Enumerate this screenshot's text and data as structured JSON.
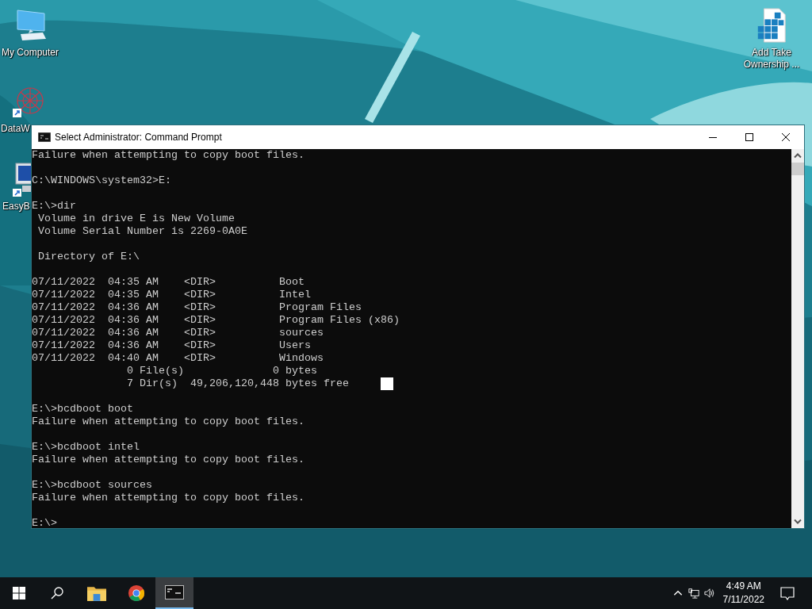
{
  "desktop": {
    "icons": [
      {
        "label": "My Computer",
        "kind": "computer",
        "shortcut": false
      },
      {
        "label": "DataW",
        "kind": "network",
        "shortcut": true
      },
      {
        "label": "EasyB",
        "kind": "easyb",
        "shortcut": true
      },
      {
        "label": "Add Take Ownership ...",
        "kind": "registry",
        "shortcut": false
      }
    ]
  },
  "window": {
    "title": "Select Administrator: Command Prompt",
    "console": [
      {
        "lines": [
          "Failure when attempting to copy boot files."
        ],
        "cursor": false
      },
      {
        "lines": [
          "C:\\WINDOWS\\system32>E:"
        ],
        "cursor": false
      },
      {
        "lines": [
          "E:\\>dir",
          " Volume in drive E is New Volume",
          " Volume Serial Number is 2269-0A0E"
        ],
        "cursor": false
      },
      {
        "lines": [
          " Directory of E:\\"
        ],
        "cursor": false
      },
      {
        "lines": [
          "07/11/2022  04:35 AM    <DIR>          Boot",
          "07/11/2022  04:35 AM    <DIR>          Intel",
          "07/11/2022  04:36 AM    <DIR>          Program Files",
          "07/11/2022  04:36 AM    <DIR>          Program Files (x86)",
          "07/11/2022  04:36 AM    <DIR>          sources",
          "07/11/2022  04:36 AM    <DIR>          Users",
          "07/11/2022  04:40 AM    <DIR>          Windows",
          "               0 File(s)              0 bytes",
          "               7 Dir(s)  49,206,120,448 bytes free"
        ],
        "cursor": true
      },
      {
        "lines": [
          "E:\\>bcdboot boot",
          "Failure when attempting to copy boot files."
        ],
        "cursor": false
      },
      {
        "lines": [
          "E:\\>bcdboot intel",
          "Failure when attempting to copy boot files."
        ],
        "cursor": false
      },
      {
        "lines": [
          "E:\\>bcdboot sources",
          "Failure when attempting to copy boot files."
        ],
        "cursor": false
      },
      {
        "lines": [
          "E:\\>"
        ],
        "cursor": false
      }
    ]
  },
  "taskbar": {
    "items": [
      {
        "kind": "start",
        "selected": false
      },
      {
        "kind": "search",
        "selected": false
      },
      {
        "kind": "explorer",
        "selected": false
      },
      {
        "kind": "chrome",
        "selected": false
      },
      {
        "kind": "cmd",
        "selected": true
      }
    ],
    "tray": {
      "time": "4:49 AM",
      "date": "7/11/2022"
    }
  }
}
